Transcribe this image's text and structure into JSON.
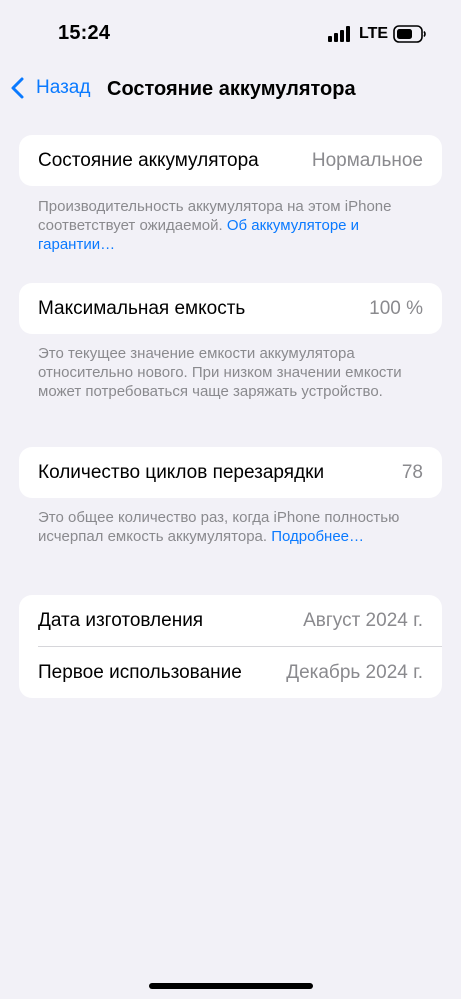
{
  "status_bar": {
    "time": "15:24",
    "network": "LTE",
    "battery_icon": "battery-half-icon",
    "signal_icon": "cellular-signal-icon"
  },
  "nav": {
    "back_label": "Назад",
    "title": "Состояние аккумулятора"
  },
  "health_group": {
    "label": "Состояние аккумулятора",
    "value": "Нормальное",
    "footnote_text": "Производительность аккумулятора на этом iPhone соответствует ожидаемой. ",
    "footnote_link": "Об аккумуляторе и гарантии…"
  },
  "capacity_group": {
    "label": "Максимальная емкость",
    "value": "100 %",
    "footnote_text": "Это текущее значение емкости аккумулятора относительно нового. При низком значении емкости может потребоваться чаще заряжать устройство."
  },
  "cycles_group": {
    "label": "Количество циклов перезарядки",
    "value": "78",
    "footnote_text": "Это общее количество раз, когда iPhone полностью исчерпал емкость аккумулятора. ",
    "footnote_link": "Подробнее…"
  },
  "dates_group": {
    "manufacture_label": "Дата изготовления",
    "manufacture_value": "Август 2024 г.",
    "first_use_label": "Первое использование",
    "first_use_value": "Декабрь 2024 г."
  },
  "colors": {
    "accent": "#0a7aff",
    "background": "#f2f1f7",
    "secondary_text": "#8a8a8e"
  }
}
